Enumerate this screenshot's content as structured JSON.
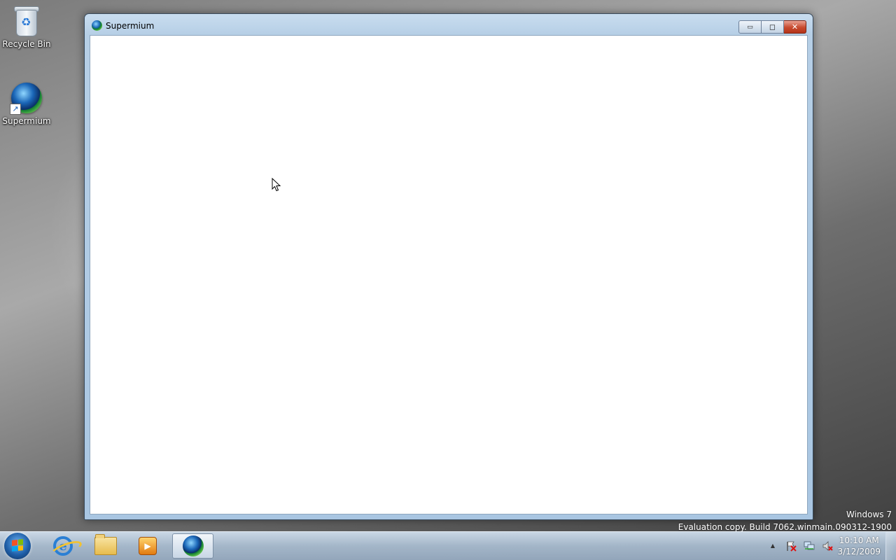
{
  "desktop": {
    "icons": [
      {
        "label": "Recycle Bin",
        "icon": "recycle-bin-icon"
      },
      {
        "label": "Supermium",
        "icon": "supermium-icon"
      }
    ]
  },
  "window": {
    "title": "Supermium",
    "controls": {
      "minimize": "▭",
      "maximize": "◻",
      "close": "✕"
    }
  },
  "watermark": {
    "line1": "Windows 7",
    "line2": "Evaluation copy. Build 7062.winmain.090312-1900"
  },
  "taskbar": {
    "pinned": [
      {
        "name": "internet-explorer-icon"
      },
      {
        "name": "windows-explorer-icon"
      },
      {
        "name": "media-player-icon"
      },
      {
        "name": "supermium-icon",
        "active": true
      }
    ],
    "tray": {
      "expand_glyph": "▲",
      "icons": [
        "action-center-flag-icon",
        "network-icon",
        "volume-muted-icon"
      ]
    },
    "clock": {
      "time": "10:10 AM",
      "date": "3/12/2009"
    }
  }
}
